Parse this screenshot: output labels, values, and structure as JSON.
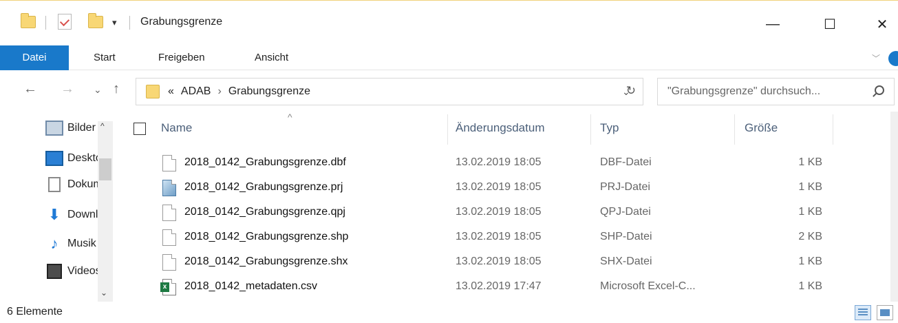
{
  "window": {
    "title": "Grabungsgrenze",
    "controls": {
      "minimize": "—",
      "maximize": "☐",
      "close": "✕"
    },
    "quick_access_dropdown": "▾"
  },
  "ribbon": {
    "tabs": [
      {
        "label": "Datei",
        "active": true
      },
      {
        "label": "Start"
      },
      {
        "label": "Freigeben"
      },
      {
        "label": "Ansicht"
      }
    ],
    "expand_icon": "﹀"
  },
  "address": {
    "back": "←",
    "forward": "→",
    "recent": "⌄",
    "up": "↑",
    "overflow": "«",
    "breadcrumb": [
      "ADAB",
      "Grabungsgrenze"
    ],
    "separator": "›",
    "dropdown": "⌄",
    "refresh": "↻"
  },
  "search": {
    "placeholder": "\"Grabungsgrenze\" durchsuch..."
  },
  "navpane": {
    "items": [
      {
        "label": "Bilder",
        "icon": "pictures-icon"
      },
      {
        "label": "Desktop",
        "icon": "desktop-icon"
      },
      {
        "label": "Dokumente",
        "icon": "documents-icon"
      },
      {
        "label": "Downloads",
        "icon": "downloads-icon"
      },
      {
        "label": "Musik",
        "icon": "music-icon"
      },
      {
        "label": "Videos",
        "icon": "videos-icon"
      }
    ],
    "scroll_up": "^",
    "scroll_down": "⌄"
  },
  "columns": {
    "sort_indicator": "^",
    "name": "Name",
    "date": "Änderungsdatum",
    "type": "Typ",
    "size": "Größe"
  },
  "files": [
    {
      "name": "2018_0142_Grabungsgrenze.dbf",
      "date": "13.02.2019 18:05",
      "type": "DBF-Datei",
      "size": "1 KB",
      "icon": "file-icon"
    },
    {
      "name": "2018_0142_Grabungsgrenze.prj",
      "date": "13.02.2019 18:05",
      "type": "PRJ-Datei",
      "size": "1 KB",
      "icon": "prj-file-icon"
    },
    {
      "name": "2018_0142_Grabungsgrenze.qpj",
      "date": "13.02.2019 18:05",
      "type": "QPJ-Datei",
      "size": "1 KB",
      "icon": "file-icon"
    },
    {
      "name": "2018_0142_Grabungsgrenze.shp",
      "date": "13.02.2019 18:05",
      "type": "SHP-Datei",
      "size": "2 KB",
      "icon": "file-icon"
    },
    {
      "name": "2018_0142_Grabungsgrenze.shx",
      "date": "13.02.2019 18:05",
      "type": "SHX-Datei",
      "size": "1 KB",
      "icon": "file-icon"
    },
    {
      "name": "2018_0142_metadaten.csv",
      "date": "13.02.2019 17:47",
      "type": "Microsoft Excel-C...",
      "size": "1 KB",
      "icon": "excel-csv-icon"
    }
  ],
  "status": {
    "count_text": "6 Elemente"
  },
  "colors": {
    "accent": "#1979ca",
    "folder": "#f8d775",
    "header_text": "#4c607a"
  }
}
